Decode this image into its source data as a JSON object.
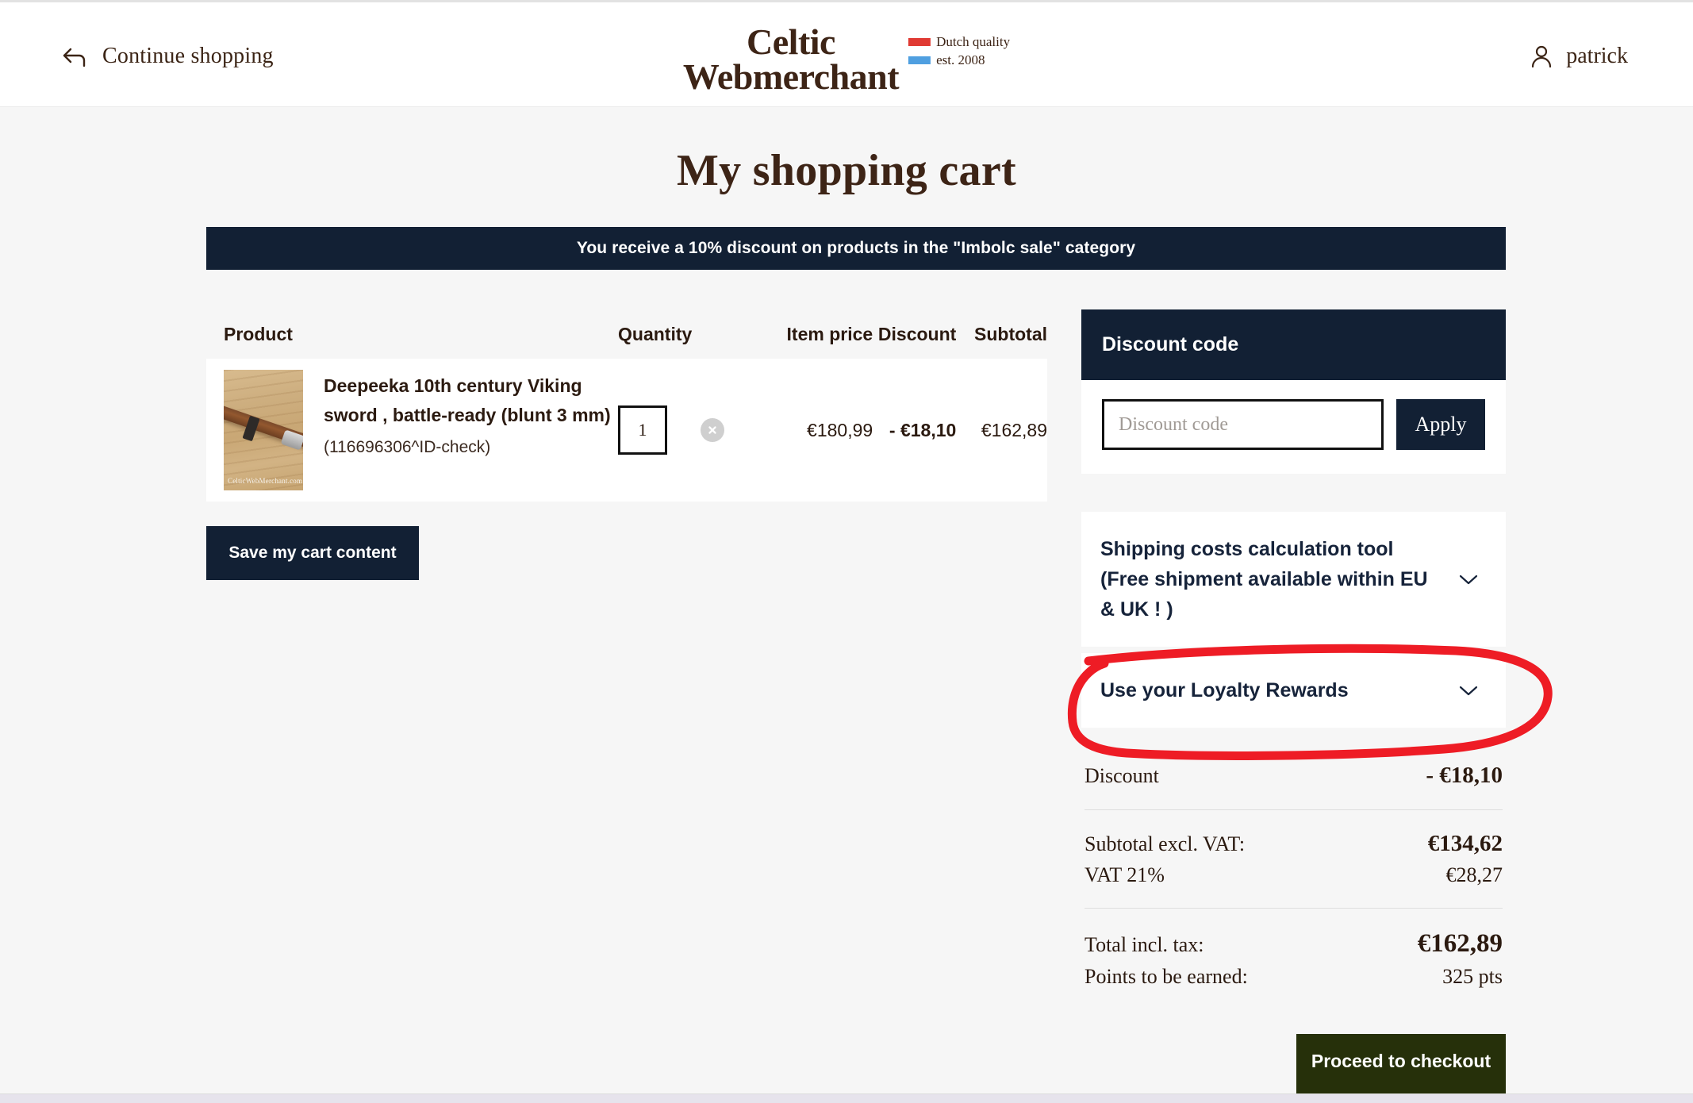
{
  "header": {
    "continue_shopping_label": "Continue shopping",
    "brand": {
      "line1": "Celtic",
      "line2": "Webmerchant",
      "badge_quality": "Dutch quality",
      "badge_est": "est. 2008",
      "bar_red": "#e03a33",
      "bar_blue": "#4f9fe0"
    },
    "account_name": "patrick"
  },
  "page": {
    "title": "My shopping cart",
    "promo_banner": "You receive a 10% discount on products in the \"Imbolc sale\" category",
    "accent_navy": "#122034",
    "accent_green": "#26300a",
    "annotation_color": "#ee1c25",
    "background": "#f6f6f6"
  },
  "cart": {
    "columns": {
      "product": "Product",
      "quantity": "Quantity",
      "item_price": "Item price",
      "discount": "Discount",
      "subtotal": "Subtotal"
    },
    "items": [
      {
        "name": "Deepeeka 10th century Viking sword , battle-ready (blunt 3 mm)",
        "sku": "(116696306^ID-check)",
        "image_watermark": "CelticWebMerchant.com",
        "quantity": "1",
        "item_price": "€180,99",
        "discount": "- €18,10",
        "subtotal": "€162,89"
      }
    ],
    "save_cart_label": "Save my cart content"
  },
  "discount_code": {
    "panel_title": "Discount code",
    "input_value": "",
    "input_placeholder": "Discount code",
    "apply_label": "Apply"
  },
  "accordions": [
    {
      "label": "Shipping costs calculation tool (Free shipment available within EU & UK ! )"
    },
    {
      "label": "Use your Loyalty Rewards"
    }
  ],
  "totals": {
    "discount_label": "Discount",
    "discount_value": "- €18,10",
    "subtotal_excl_vat_label": "Subtotal excl. VAT:",
    "subtotal_excl_vat_value": "€134,62",
    "vat_label": "VAT 21%",
    "vat_value": "€28,27",
    "total_label": "Total incl. tax:",
    "total_value": "€162,89",
    "points_label": "Points to be earned:",
    "points_value": "325 pts"
  },
  "checkout": {
    "label": "Proceed to checkout"
  }
}
